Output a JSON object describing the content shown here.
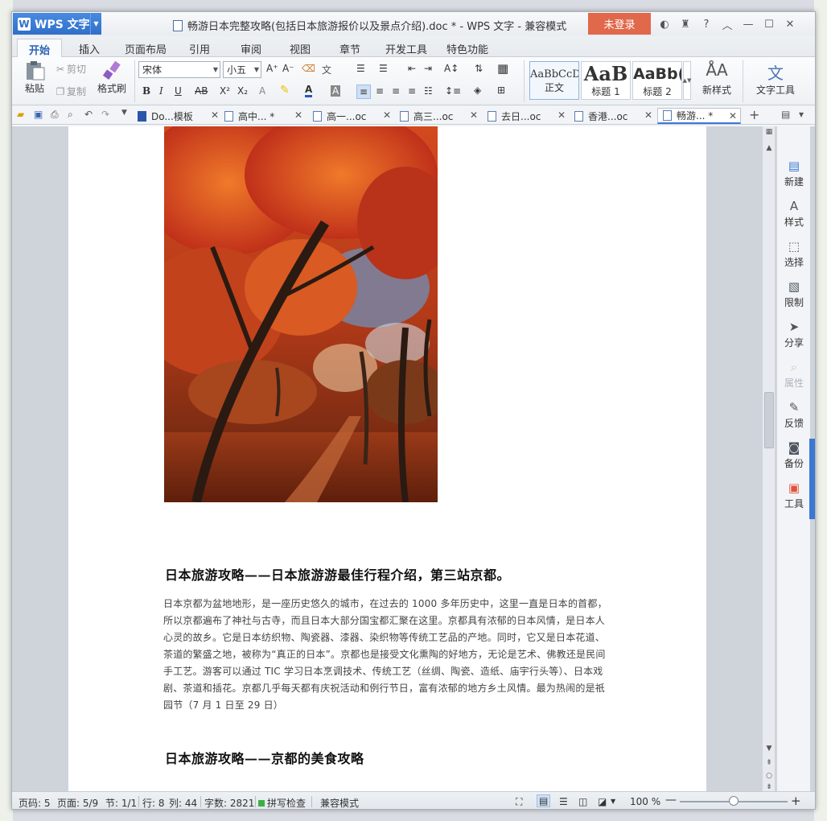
{
  "window": {
    "app_name": "WPS 文字",
    "app_logo": "W",
    "doc_title": "畅游日本完整攻略(包括日本旅游报价以及景点介绍).doc * - WPS 文字 - 兼容模式",
    "login_label": "未登录"
  },
  "ribbon_tabs": [
    "开始",
    "插入",
    "页面布局",
    "引用",
    "审阅",
    "视图",
    "章节",
    "开发工具",
    "特色功能"
  ],
  "ribbon": {
    "paste": "粘贴",
    "cut": "剪切",
    "copy": "复制",
    "format_painter": "格式刷",
    "font_name": "宋体",
    "font_size": "小五",
    "new_style": "新样式",
    "text_tools": "文字工具",
    "styles": [
      {
        "sample": "AaBbCcD",
        "name": "正文"
      },
      {
        "sample": "AaB",
        "name": "标题 1"
      },
      {
        "sample": "AaBb(",
        "name": "标题 2"
      }
    ]
  },
  "doc_tabs": [
    {
      "label": "Do...模板",
      "active": false
    },
    {
      "label": "高中... *",
      "active": false
    },
    {
      "label": "高一...oc",
      "active": false
    },
    {
      "label": "高三...oc",
      "active": false
    },
    {
      "label": "去日...oc",
      "active": false
    },
    {
      "label": "香港...oc",
      "active": false
    },
    {
      "label": "畅游... *",
      "active": true
    }
  ],
  "document": {
    "heading1": "日本旅游攻略——日本旅游游最佳行程介绍，第三站京都。",
    "paragraph": "日本京都为盆地地形，是一座历史悠久的城市，在过去的 1000 多年历史中，这里一直是日本的首都，所以京都遍布了神社与古寺，而且日本大部分国宝都汇聚在这里。京都具有浓郁的日本风情，是日本人心灵的故乡。它是日本纺织物、陶瓷器、漆器、染织物等传统工艺品的产地。同时，它又是日本花道、茶道的繁盛之地，被称为“真正的日本”。京都也是接受文化熏陶的好地方，无论是艺术、佛教还是民间手工艺。游客可以通过 TIC 学习日本烹调技术、传统工艺（丝绸、陶瓷、造纸、庙宇行头等）、日本戏剧、茶道和插花。京都几乎每天都有庆祝活动和例行节日，富有浓郁的地方乡土风情。最为热闹的是祇园节（7 月 1 日至 29 日）",
    "heading2": "日本旅游攻略——京都的美食攻略"
  },
  "side_panel": [
    {
      "label": "新建",
      "icon": "new-doc-icon",
      "glyph": "▤",
      "disabled": false
    },
    {
      "label": "样式",
      "icon": "style-icon",
      "glyph": "A",
      "disabled": false
    },
    {
      "label": "选择",
      "icon": "select-icon",
      "glyph": "⬚",
      "disabled": false
    },
    {
      "label": "限制",
      "icon": "restrict-icon",
      "glyph": "▧",
      "disabled": false
    },
    {
      "label": "分享",
      "icon": "share-icon",
      "glyph": "➤",
      "disabled": false
    },
    {
      "label": "属性",
      "icon": "properties-icon",
      "glyph": "⌕",
      "disabled": true
    },
    {
      "label": "反馈",
      "icon": "feedback-icon",
      "glyph": "✎",
      "disabled": false
    },
    {
      "label": "备份",
      "icon": "backup-icon",
      "glyph": "◙",
      "disabled": false
    },
    {
      "label": "工具",
      "icon": "toolbox-icon",
      "glyph": "▣",
      "disabled": false
    }
  ],
  "status": {
    "page_code": "页码: 5",
    "pages": "页面: 5/9",
    "section": "节: 1/1",
    "row": "行: 8",
    "col": "列: 44",
    "word_count": "字数: 2821",
    "spell_check": "拼写检查",
    "compat_mode": "兼容模式",
    "zoom": "100 %"
  },
  "colors": {
    "accent": "#3b78d8",
    "login": "#e0684b",
    "tools": "#e0523a"
  }
}
